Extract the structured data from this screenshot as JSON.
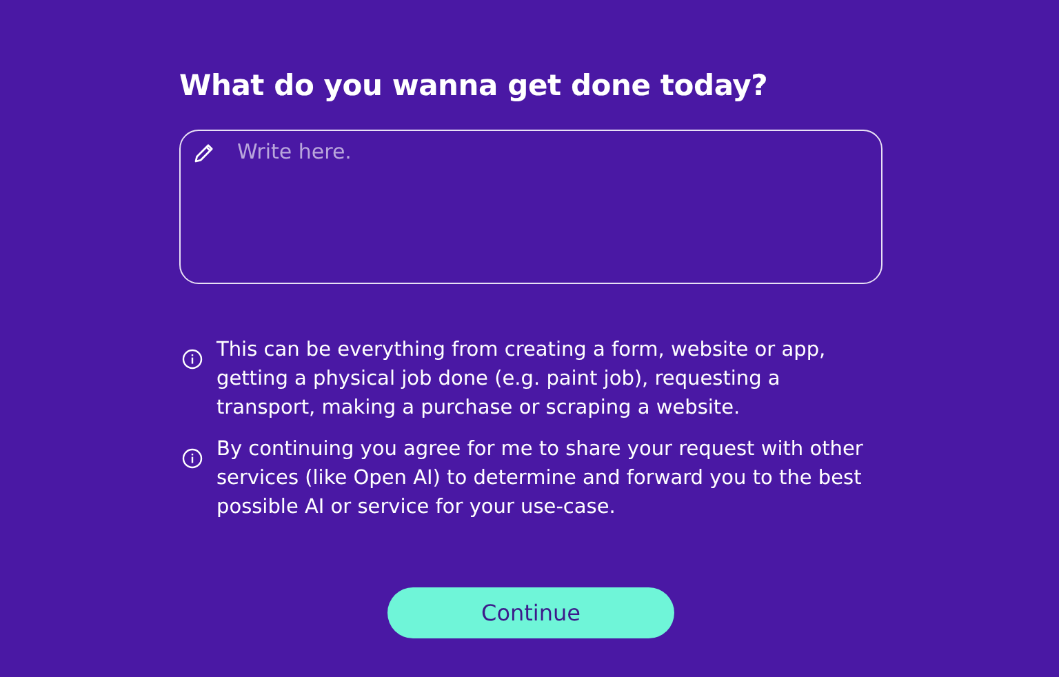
{
  "heading": "What do you wanna get done today?",
  "request_field": {
    "placeholder": "Write here."
  },
  "notes": [
    {
      "text": "This can be everything from creating a form, website or app, getting a physical job done (e.g. paint job), requesting a transport, making a purchase or scraping a website."
    },
    {
      "text": "By continuing you agree for me to share your request with other services (like Open AI) to determine and forward you to the best possible AI or service for your use-case."
    }
  ],
  "button": {
    "label": "Continue"
  }
}
